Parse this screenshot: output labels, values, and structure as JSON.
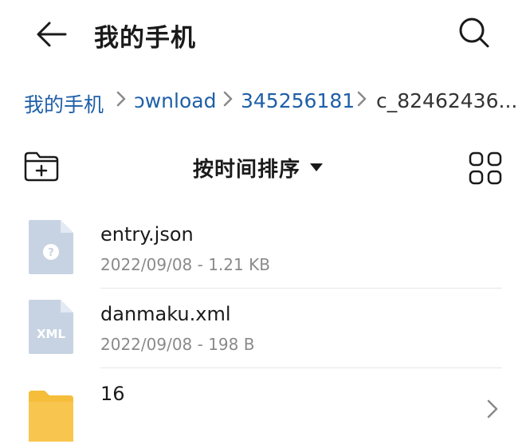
{
  "header": {
    "title": "我的手机",
    "back_icon": "arrow-left-icon",
    "search_icon": "search-icon"
  },
  "breadcrumb": {
    "items": [
      {
        "label": "我的手机",
        "current": false
      },
      {
        "label": "ɔwnload",
        "current": false
      },
      {
        "label": "345256181",
        "current": false
      },
      {
        "label": "c_82462436...",
        "current": true
      }
    ],
    "separator_icon": "chevron-right-icon"
  },
  "toolbar": {
    "new_folder_icon": "new-folder-icon",
    "sort_label": "按时间排序",
    "sort_caret_icon": "caret-down-icon",
    "view_toggle_icon": "grid-view-icon"
  },
  "files": [
    {
      "name": "entry.json",
      "meta": "2022/09/08 - 1.21 KB",
      "icon": "unknown-file-icon",
      "badge": "?"
    },
    {
      "name": "danmaku.xml",
      "meta": "2022/09/08 - 198 B",
      "icon": "xml-file-icon",
      "badge": "XML"
    },
    {
      "name": "16",
      "meta": "",
      "icon": "folder-icon",
      "badge": ""
    }
  ],
  "colors": {
    "link": "#1f5fa8",
    "file_icon": "#c7d3e2",
    "folder": "#f6bd3b",
    "text_secondary": "#8a8a8a"
  }
}
